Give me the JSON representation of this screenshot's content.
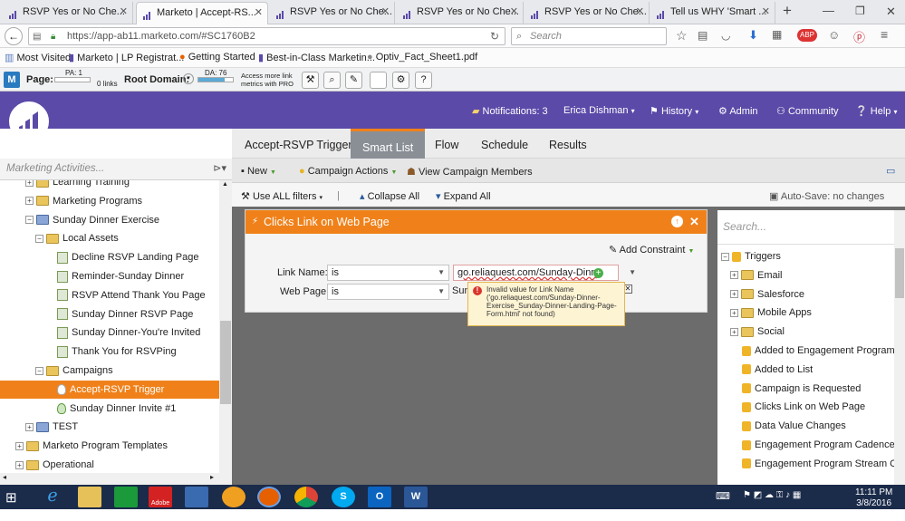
{
  "browser": {
    "tabs": [
      {
        "label": "RSVP Yes or No Che...",
        "active": false
      },
      {
        "label": "Marketo | Accept-RS...",
        "active": true
      },
      {
        "label": "RSVP Yes or No Che...",
        "active": false
      },
      {
        "label": "RSVP Yes or No Che...",
        "active": false
      },
      {
        "label": "RSVP Yes or No Che...",
        "active": false
      },
      {
        "label": "Tell us WHY 'Smart ...",
        "active": false
      }
    ],
    "url": "https://app-ab11.marketo.com/#SC1760B2",
    "search_placeholder": "Search",
    "bookmarks": [
      "Most Visited",
      "Marketo | LP Registrat...",
      "Getting Started",
      "Best-in-Class Marketin...",
      "Optiv_Fact_Sheet1.pdf"
    ]
  },
  "mozbar": {
    "page_label": "Page:",
    "pa": "PA: 1",
    "links": "0 links",
    "root_domain_label": "Root Domain:",
    "da": "DA: 76",
    "pro_text_1": "Access more link",
    "pro_text_2": "metrics with PRO"
  },
  "header": {
    "notifications": "Notifications: 3",
    "user": "Erica Dishman",
    "history": "History",
    "admin": "Admin",
    "community": "Community",
    "help": "Help"
  },
  "main_tabs": [
    "Accept-RSVP Trigger",
    "Smart List",
    "Flow",
    "Schedule",
    "Results"
  ],
  "left_panel": {
    "search_placeholder": "Marketing Activities...",
    "tree": [
      {
        "label": "Learning Training",
        "level": 2,
        "icon": "folder",
        "pm": "+"
      },
      {
        "label": "Marketing Programs",
        "level": 2,
        "icon": "folder",
        "pm": "+"
      },
      {
        "label": "Sunday Dinner Exercise",
        "level": 2,
        "icon": "program",
        "pm": "-"
      },
      {
        "label": "Local Assets",
        "level": 3,
        "icon": "folder",
        "pm": "-"
      },
      {
        "label": "Decline RSVP Landing Page",
        "level": 4,
        "icon": "page"
      },
      {
        "label": "Reminder-Sunday Dinner",
        "level": 4,
        "icon": "page"
      },
      {
        "label": "RSVP Attend Thank You Page",
        "level": 4,
        "icon": "page"
      },
      {
        "label": "Sunday Dinner RSVP Page",
        "level": 4,
        "icon": "page"
      },
      {
        "label": "Sunday Dinner-You're Invited",
        "level": 4,
        "icon": "page"
      },
      {
        "label": "Thank You for RSVPing",
        "level": 4,
        "icon": "page"
      },
      {
        "label": "Campaigns",
        "level": 3,
        "icon": "folder",
        "pm": "-"
      },
      {
        "label": "Accept-RSVP Trigger",
        "level": 4,
        "icon": "bulb",
        "selected": true
      },
      {
        "label": "Sunday Dinner Invite #1",
        "level": 4,
        "icon": "bulb"
      },
      {
        "label": "TEST",
        "level": 2,
        "icon": "program",
        "pm": "+"
      },
      {
        "label": "Marketo Program Templates",
        "level": 1,
        "icon": "folder",
        "pm": "+"
      },
      {
        "label": "Operational",
        "level": 1,
        "icon": "folder",
        "pm": "+"
      }
    ]
  },
  "toolbar": {
    "new": "New",
    "campaign_actions": "Campaign Actions",
    "view_members": "View Campaign Members",
    "use_all_filters": "Use ALL filters",
    "collapse_all": "Collapse All",
    "expand_all": "Expand All",
    "autosave": "Auto-Save: no changes"
  },
  "filter": {
    "title": "Clicks Link on Web Page",
    "add_constraint": "Add Constraint",
    "link_name_label": "Link Name:",
    "link_name_op": "is",
    "link_name_value": "go.reliaquest.com/Sunday-Dinn",
    "web_page_label": "Web Page:",
    "web_page_op": "is",
    "web_page_value": "Sun",
    "error_text": "Invalid value for Link Name ('go.reliaquest.com/Sunday-Dinner-Exercise_Sunday-Dinner-Landing-Page-Form.html' not found)"
  },
  "right_panel": {
    "search_placeholder": "Search...",
    "items": [
      {
        "label": "Triggers",
        "level": 0,
        "pm": "-"
      },
      {
        "label": "Email",
        "level": 1,
        "pm": "+",
        "icon": "folder"
      },
      {
        "label": "Salesforce",
        "level": 1,
        "pm": "+",
        "icon": "folder"
      },
      {
        "label": "Mobile Apps",
        "level": 1,
        "pm": "+",
        "icon": "folder"
      },
      {
        "label": "Social",
        "level": 1,
        "pm": "+",
        "icon": "folder"
      },
      {
        "label": "Added to Engagement Program",
        "level": 1,
        "icon": "bolt"
      },
      {
        "label": "Added to List",
        "level": 1,
        "icon": "bolt"
      },
      {
        "label": "Campaign is Requested",
        "level": 1,
        "icon": "bolt"
      },
      {
        "label": "Clicks Link on Web Page",
        "level": 1,
        "icon": "bolt"
      },
      {
        "label": "Data Value Changes",
        "level": 1,
        "icon": "bolt"
      },
      {
        "label": "Engagement Program Cadence Ch",
        "level": 1,
        "icon": "bolt"
      },
      {
        "label": "Engagement Program Stream Chai",
        "level": 1,
        "icon": "bolt"
      }
    ]
  },
  "taskbar": {
    "time": "11:11 PM",
    "date": "3/8/2016"
  },
  "colors": {
    "marketo_purple": "#5b4aa8",
    "accent_orange": "#f0811a",
    "taskbar": "#1b2b4a"
  }
}
